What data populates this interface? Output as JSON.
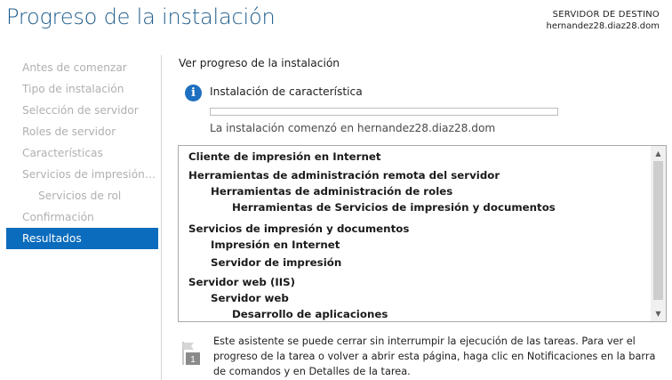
{
  "header": {
    "title": "Progreso de la instalación",
    "destination_label": "SERVIDOR DE DESTINO",
    "destination_server": "hernandez28.diaz28.dom"
  },
  "sidebar": {
    "items": [
      {
        "label": "Antes de comenzar"
      },
      {
        "label": "Tipo de instalación"
      },
      {
        "label": "Selección de servidor"
      },
      {
        "label": "Roles de servidor"
      },
      {
        "label": "Características"
      },
      {
        "label": "Servicios de impresión y documentos"
      },
      {
        "label": "Servicios de rol"
      },
      {
        "label": "Confirmación"
      },
      {
        "label": "Resultados"
      }
    ]
  },
  "main": {
    "section_title": "Ver progreso de la instalación",
    "status_title": "Instalación de característica",
    "progress_fraction": 0,
    "status_message": "La instalación comenzó en hernandez28.diaz28.dom",
    "results": [
      {
        "label": "Cliente de impresión en Internet",
        "level": 0
      },
      {
        "label": "Herramientas de administración remota del servidor",
        "level": 0
      },
      {
        "label": "Herramientas de administración de roles",
        "level": 1
      },
      {
        "label": "Herramientas de Servicios de impresión y documentos",
        "level": 2
      },
      {
        "label": "Servicios de impresión y documentos",
        "level": 0
      },
      {
        "label": "Impresión en Internet",
        "level": 1
      },
      {
        "label": "Servidor de impresión",
        "level": 1
      },
      {
        "label": "Servidor web (IIS)",
        "level": 0
      },
      {
        "label": "Servidor web",
        "level": 1
      },
      {
        "label": "Desarrollo de aplicaciones",
        "level": 2
      }
    ],
    "note": "Este asistente se puede cerrar sin interrumpir la ejecución de las tareas. Para ver el progreso de la tarea o volver a abrir esta página, haga clic en Notificaciones en la barra de comandos y en Detalles de la tarea.",
    "note_badge": "1"
  },
  "icons": {
    "info": "info-icon",
    "notification_flag": "flag-icon",
    "scroll_up": "chevron-up-icon",
    "scroll_down": "chevron-down-icon"
  },
  "colors": {
    "title": "#1f5d8c",
    "active_nav": "#0b6cbd",
    "disabled_nav": "#b0b0b0",
    "info_icon": "#1e6fc0"
  }
}
